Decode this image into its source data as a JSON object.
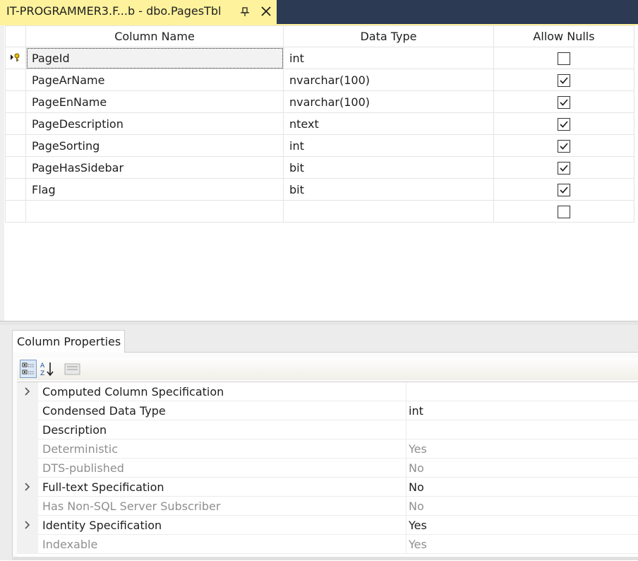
{
  "document_tab": {
    "title": "IT-PROGRAMMER3.F...b - dbo.PagesTbl",
    "pin_icon": "pin-icon",
    "close_icon": "close-icon"
  },
  "design_grid": {
    "columns": [
      "Column Name",
      "Data Type",
      "Allow Nulls"
    ],
    "rows": [
      {
        "name": "PageId",
        "type": "int",
        "allow_nulls": false,
        "primary_key": true
      },
      {
        "name": "PageArName",
        "type": "nvarchar(100)",
        "allow_nulls": true
      },
      {
        "name": "PageEnName",
        "type": "nvarchar(100)",
        "allow_nulls": true
      },
      {
        "name": "PageDescription",
        "type": "ntext",
        "allow_nulls": true
      },
      {
        "name": "PageSorting",
        "type": "int",
        "allow_nulls": true
      },
      {
        "name": "PageHasSidebar",
        "type": "bit",
        "allow_nulls": true
      },
      {
        "name": "Flag",
        "type": "bit",
        "allow_nulls": true
      },
      {
        "name": "",
        "type": "",
        "allow_nulls": false
      }
    ]
  },
  "properties": {
    "tab_label": "Column Properties",
    "toolbar": [
      "categorized-icon",
      "alphabetical-sort-icon",
      "property-pages-icon"
    ],
    "rows": [
      {
        "name": "Computed Column Specification",
        "value": "",
        "expandable": true,
        "disabled": false
      },
      {
        "name": "Condensed Data Type",
        "value": "int",
        "expandable": false,
        "disabled": false
      },
      {
        "name": "Description",
        "value": "",
        "expandable": false,
        "disabled": false
      },
      {
        "name": "Deterministic",
        "value": "Yes",
        "expandable": false,
        "disabled": true
      },
      {
        "name": "DTS-published",
        "value": "No",
        "expandable": false,
        "disabled": true
      },
      {
        "name": "Full-text Specification",
        "value": "No",
        "expandable": true,
        "disabled": false
      },
      {
        "name": "Has Non-SQL Server Subscriber",
        "value": "No",
        "expandable": false,
        "disabled": true
      },
      {
        "name": "Identity Specification",
        "value": "Yes",
        "expandable": true,
        "disabled": false
      },
      {
        "name": "Indexable",
        "value": "Yes",
        "expandable": false,
        "disabled": true
      }
    ]
  },
  "colors": {
    "tab_active": "#fff29d",
    "tabstrip_bg": "#2d3a54",
    "disabled_text": "#8f8f8f"
  }
}
